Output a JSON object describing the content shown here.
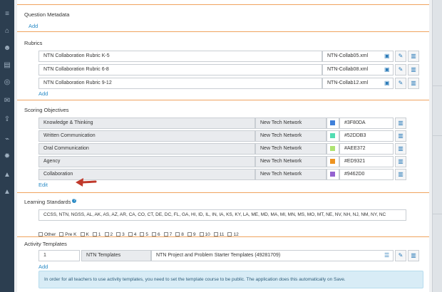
{
  "rail": {
    "icons": [
      "menu-icon",
      "bank-icon",
      "users-icon",
      "document-icon",
      "target-icon",
      "mail-icon",
      "upload-icon",
      "chart-icon",
      "gear-icon",
      "alert-icon",
      "alert-icon"
    ]
  },
  "question_metadata": {
    "title": "Question Metadata",
    "add_label": "Add"
  },
  "rubrics": {
    "title": "Rubrics",
    "add_label": "Add",
    "rows": [
      {
        "name": "NTN Collaboration Rubric K-5",
        "file": "NTN-Collab05.xml"
      },
      {
        "name": "NTN Collaboration Rubric 6-8",
        "file": "NTN-Collab08.xml"
      },
      {
        "name": "NTN Collaboration Rubric 9-12",
        "file": "NTN-Collab12.xml"
      }
    ]
  },
  "scoring_objectives": {
    "title": "Scoring Objectives",
    "edit_label": "Edit",
    "rows": [
      {
        "name": "Knowledge & Thinking",
        "owner": "New Tech Network",
        "color": "#3F80DA"
      },
      {
        "name": "Written Communication",
        "owner": "New Tech Network",
        "color": "#52DDB3"
      },
      {
        "name": "Oral Communication",
        "owner": "New Tech Network",
        "color": "#AEE372"
      },
      {
        "name": "Agency",
        "owner": "New Tech Network",
        "color": "#ED9321"
      },
      {
        "name": "Collaboration",
        "owner": "New Tech Network",
        "color": "#9462D0"
      }
    ]
  },
  "learning_standards": {
    "title": "Learning Standards",
    "value": "CCSS, NTN, NGSS, AL, AK, AS, AZ, AR, CA, CO, CT, DE, DC, FL, GA, HI, ID, IL, IN, IA, KS, KY, LA, ME, MD, MA, MI, MN, MS, MO, MT, NE, NV, NH, NJ, NM, NY, NC",
    "grades": [
      "Other",
      "Pre K",
      "K",
      "1",
      "2",
      "3",
      "4",
      "5",
      "6",
      "7",
      "8",
      "9",
      "10",
      "11",
      "12"
    ]
  },
  "activity_templates": {
    "title": "Activity Templates",
    "add_label": "Add",
    "row": {
      "number": "1",
      "name": "NTN Templates",
      "course": "NTN Project and Problem Starter Templates (49281709)"
    },
    "notice": "In order for all teachers to use activity templates, you need to set the template course to be public. The application does this automatically on Save."
  }
}
